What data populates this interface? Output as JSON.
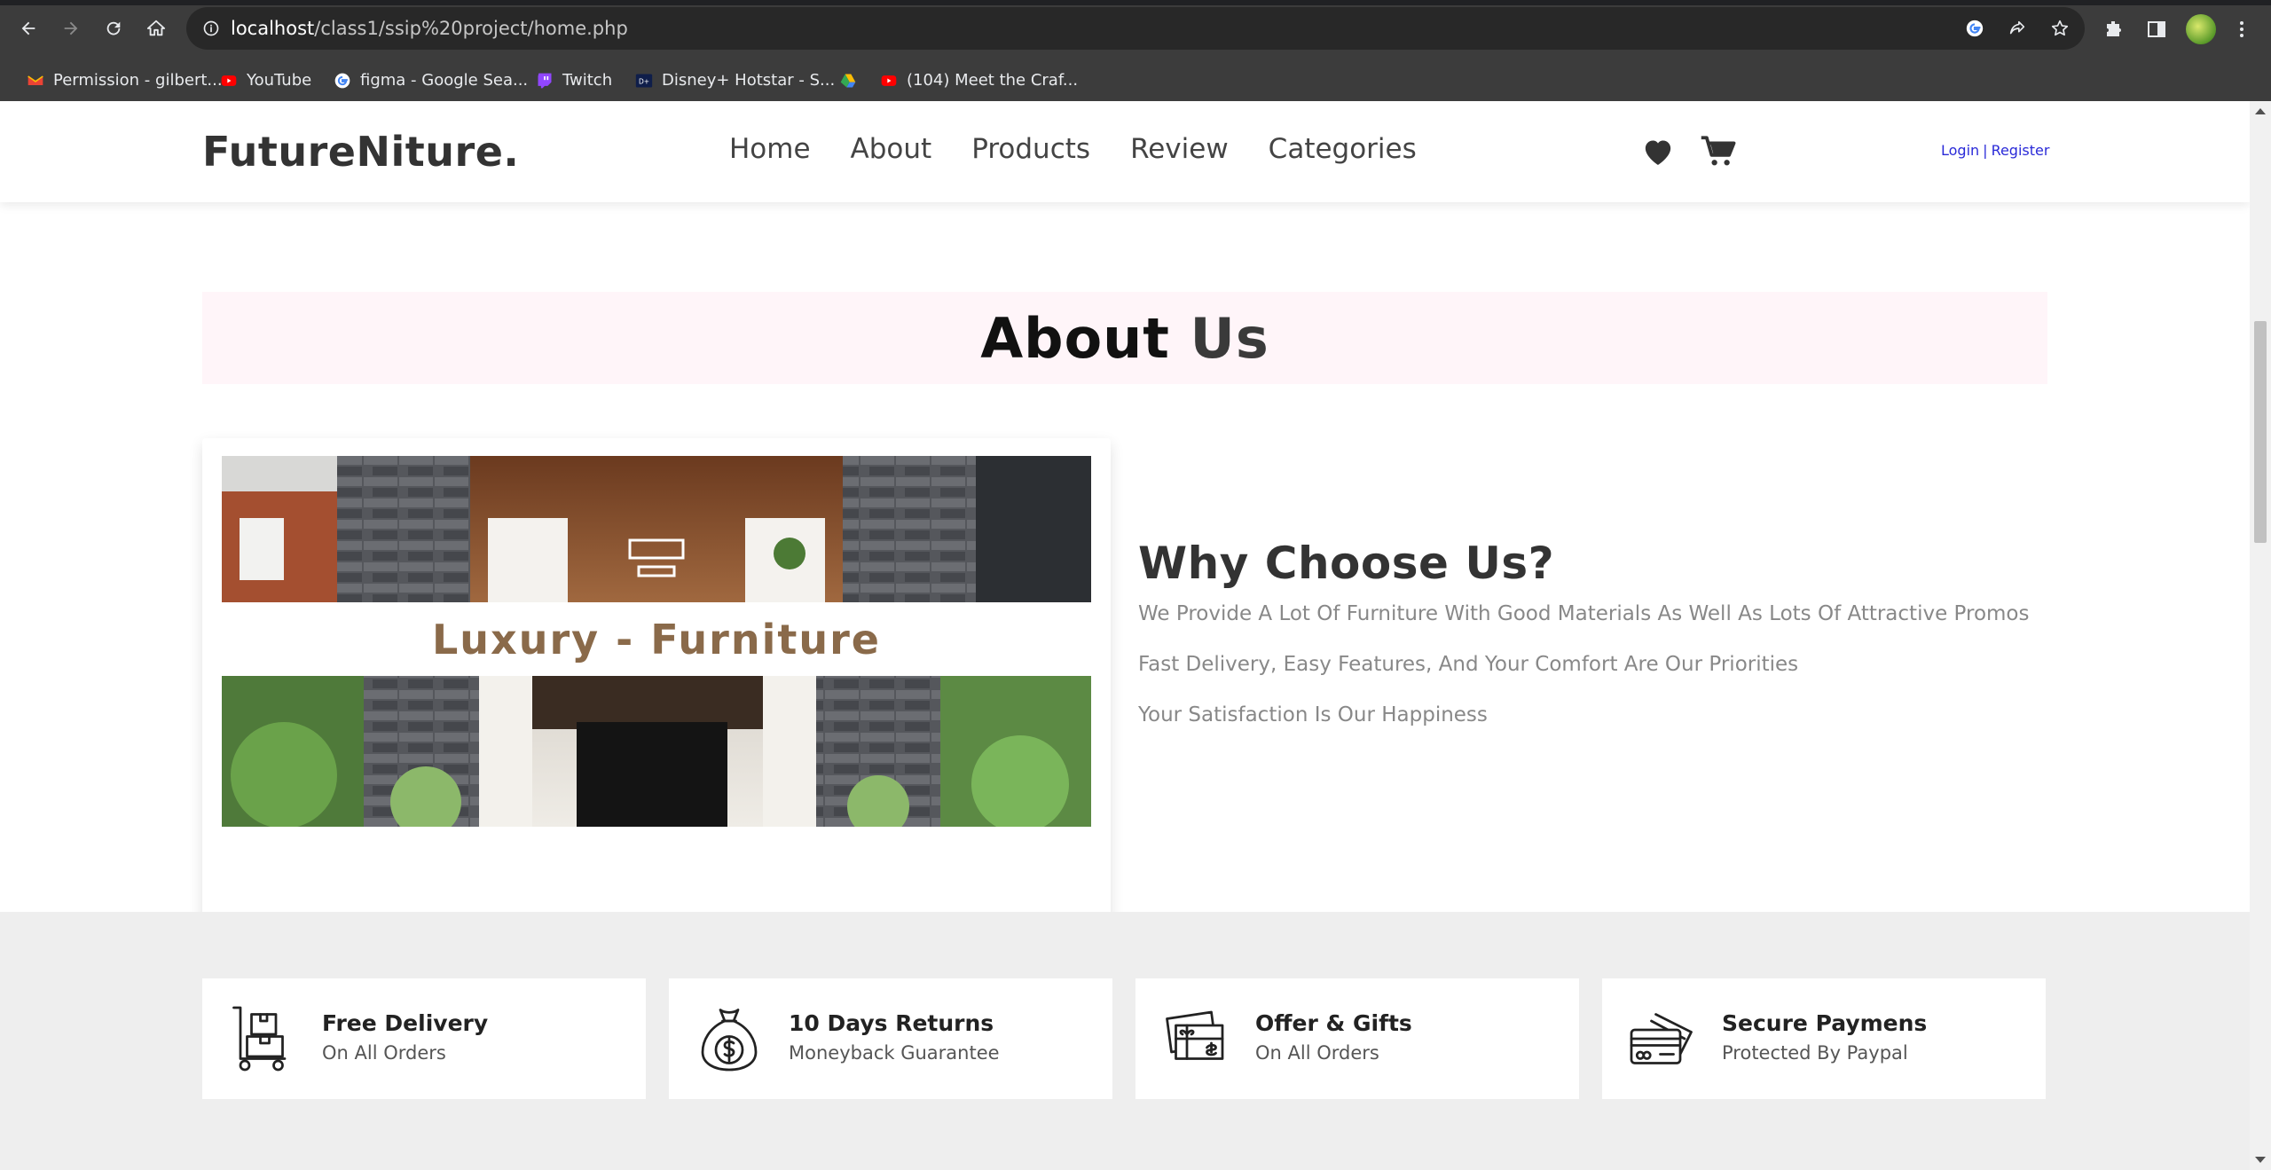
{
  "browser": {
    "url_host": "localhost",
    "url_path": "/class1/ssip%20project/home.php",
    "bookmarks": [
      {
        "label": "Permission - gilbert...",
        "icon": "gmail-icon"
      },
      {
        "label": "YouTube",
        "icon": "youtube-icon"
      },
      {
        "label": "figma - Google Sea...",
        "icon": "google-icon"
      },
      {
        "label": "Twitch",
        "icon": "twitch-icon"
      },
      {
        "label": "Disney+ Hotstar - S...",
        "icon": "hotstar-icon"
      },
      {
        "label": "",
        "icon": "google-drive-icon"
      },
      {
        "label": "(104) Meet the Craf...",
        "icon": "youtube-icon"
      }
    ]
  },
  "header": {
    "logo": "FutureNiture.",
    "nav": [
      "Home",
      "About",
      "Products",
      "Review",
      "Categories"
    ],
    "login": "Login",
    "separator": "|",
    "register": "Register"
  },
  "about": {
    "heading_word1": "About",
    "heading_word2": "Us",
    "image_caption": "Luxury - Furniture",
    "why_title": "Why Choose Us?",
    "paragraphs": [
      "We Provide A Lot Of Furniture With Good Materials As Well As Lots Of Attractive Promos",
      "Fast Delivery, Easy Features, And Your Comfort Are Our Priorities",
      "Your Satisfaction Is Our Happiness"
    ]
  },
  "features": [
    {
      "title": "Free Delivery",
      "subtitle": "On All Orders",
      "icon": "delivery-trolley-icon"
    },
    {
      "title": "10 Days Returns",
      "subtitle": "Moneyback Guarantee",
      "icon": "money-bag-icon"
    },
    {
      "title": "Offer & Gifts",
      "subtitle": "On All Orders",
      "icon": "gift-card-icon"
    },
    {
      "title": "Secure Paymens",
      "subtitle": "Protected By Paypal",
      "icon": "credit-card-icon"
    }
  ],
  "colors": {
    "auth_link": "#2a2ad8",
    "heading_band": "#fff5f9",
    "features_band": "#eeeeee",
    "muted_text": "#888888"
  }
}
